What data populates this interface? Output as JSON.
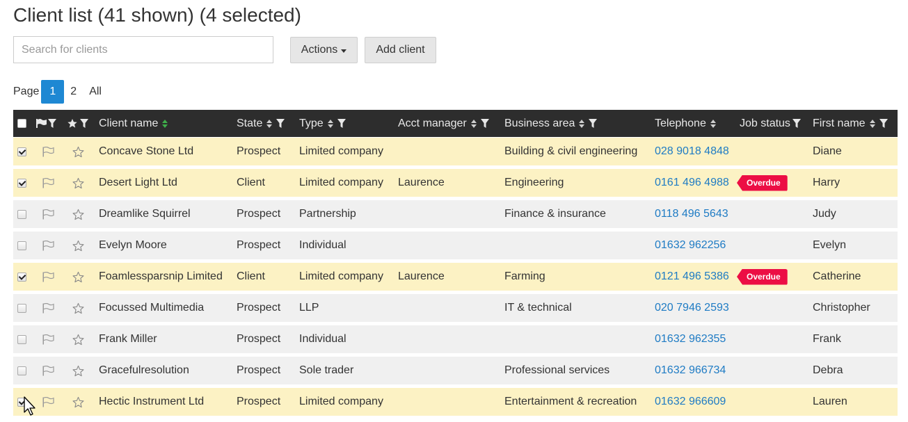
{
  "page": {
    "title": "Client list (41 shown) (4 selected)"
  },
  "toolbar": {
    "search_placeholder": "Search for clients",
    "actions_label": "Actions",
    "add_client_label": "Add client"
  },
  "pagination": {
    "label": "Page",
    "pages": [
      "1",
      "2",
      "All"
    ],
    "active": "1"
  },
  "columns": {
    "client_name": "Client name",
    "state": "State",
    "type": "Type",
    "acct_manager": "Acct manager",
    "business_area": "Business area",
    "telephone": "Telephone",
    "job_status": "Job status",
    "first_name": "First name"
  },
  "rows": [
    {
      "selected": true,
      "name": "Concave Stone Ltd",
      "state": "Prospect",
      "type": "Limited company",
      "manager": "",
      "area": "Building & civil engineering",
      "phone": "028 9018 4848",
      "status": "",
      "first": "Diane"
    },
    {
      "selected": true,
      "name": "Desert Light Ltd",
      "state": "Client",
      "type": "Limited company",
      "manager": "Laurence",
      "area": "Engineering",
      "phone": "0161 496 4988",
      "status": "Overdue",
      "first": "Harry"
    },
    {
      "selected": false,
      "name": "Dreamlike Squirrel",
      "state": "Prospect",
      "type": "Partnership",
      "manager": "",
      "area": "Finance & insurance",
      "phone": "0118 496 5643",
      "status": "",
      "first": "Judy"
    },
    {
      "selected": false,
      "name": "Evelyn Moore",
      "state": "Prospect",
      "type": "Individual",
      "manager": "",
      "area": "",
      "phone": "01632 962256",
      "status": "",
      "first": "Evelyn"
    },
    {
      "selected": true,
      "name": "Foamlessparsnip Limited",
      "state": "Client",
      "type": "Limited company",
      "manager": "Laurence",
      "area": "Farming",
      "phone": "0121 496 5386",
      "status": "Overdue",
      "first": "Catherine"
    },
    {
      "selected": false,
      "name": "Focussed Multimedia",
      "state": "Prospect",
      "type": "LLP",
      "manager": "",
      "area": "IT & technical",
      "phone": "020 7946 2593",
      "status": "",
      "first": "Christopher"
    },
    {
      "selected": false,
      "name": "Frank Miller",
      "state": "Prospect",
      "type": "Individual",
      "manager": "",
      "area": "",
      "phone": "01632 962355",
      "status": "",
      "first": "Frank"
    },
    {
      "selected": false,
      "name": "Gracefulresolution",
      "state": "Prospect",
      "type": "Sole trader",
      "manager": "",
      "area": "Professional services",
      "phone": "01632 966734",
      "status": "",
      "first": "Debra"
    },
    {
      "selected": true,
      "name": "Hectic Instrument Ltd",
      "state": "Prospect",
      "type": "Limited company",
      "manager": "",
      "area": "Entertainment & recreation",
      "phone": "01632 966609",
      "status": "",
      "first": "Lauren"
    }
  ],
  "icons": {
    "flag": "flag-icon",
    "star": "star-icon",
    "filter": "filter-icon",
    "sort": "sort-icon",
    "caret": "caret-down-icon",
    "cursor": "mouse-cursor-icon"
  },
  "colors": {
    "header_bg": "#2d2d2d",
    "selected_row": "#fcf2c4",
    "unselected_row": "#f0f0f0",
    "link": "#1e7bc4",
    "active_page": "#1e88d3",
    "overdue": "#ec0e44",
    "sort_active": "#3fb04a"
  }
}
